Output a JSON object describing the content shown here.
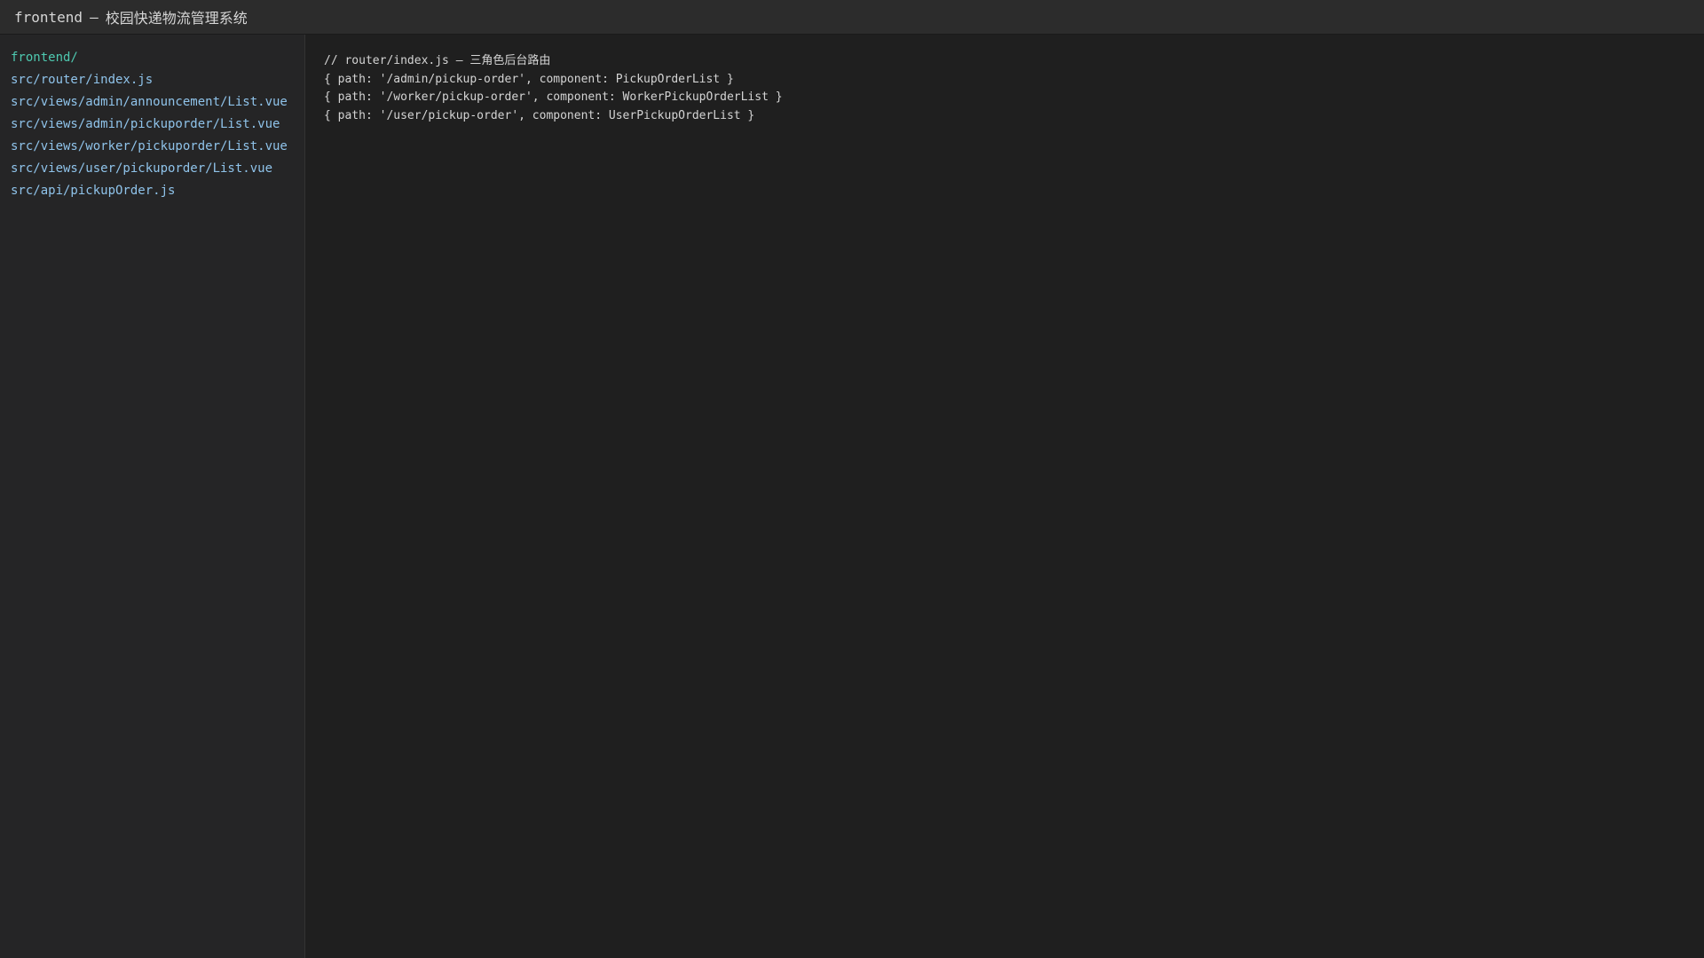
{
  "window": {
    "project": "frontend",
    "separator": "—",
    "app_name": "校园快递物流管理系统"
  },
  "sidebar": {
    "items": [
      {
        "label": "frontend/",
        "type": "folder"
      },
      {
        "label": "src/router/index.js",
        "type": "file"
      },
      {
        "label": "src/views/admin/announcement/List.vue",
        "type": "file"
      },
      {
        "label": "src/views/admin/pickuporder/List.vue",
        "type": "file"
      },
      {
        "label": "src/views/worker/pickuporder/List.vue",
        "type": "file"
      },
      {
        "label": "src/views/user/pickuporder/List.vue",
        "type": "file"
      },
      {
        "label": "src/api/pickupOrder.js",
        "type": "file"
      }
    ]
  },
  "editor": {
    "lines": [
      "// router/index.js — 三角色后台路由",
      "{ path: '/admin/pickup-order', component: PickupOrderList }",
      "{ path: '/worker/pickup-order', component: WorkerPickupOrderList }",
      "{ path: '/user/pickup-order', component: UserPickupOrderList }"
    ]
  },
  "colors": {
    "folder": "#4ec9b0",
    "file": "#8fc3ea",
    "code_text": "#d4d4d4",
    "background": "#1f1f1f",
    "sidebar_bg": "#252526",
    "titlebar_bg": "#2c2c2c"
  }
}
